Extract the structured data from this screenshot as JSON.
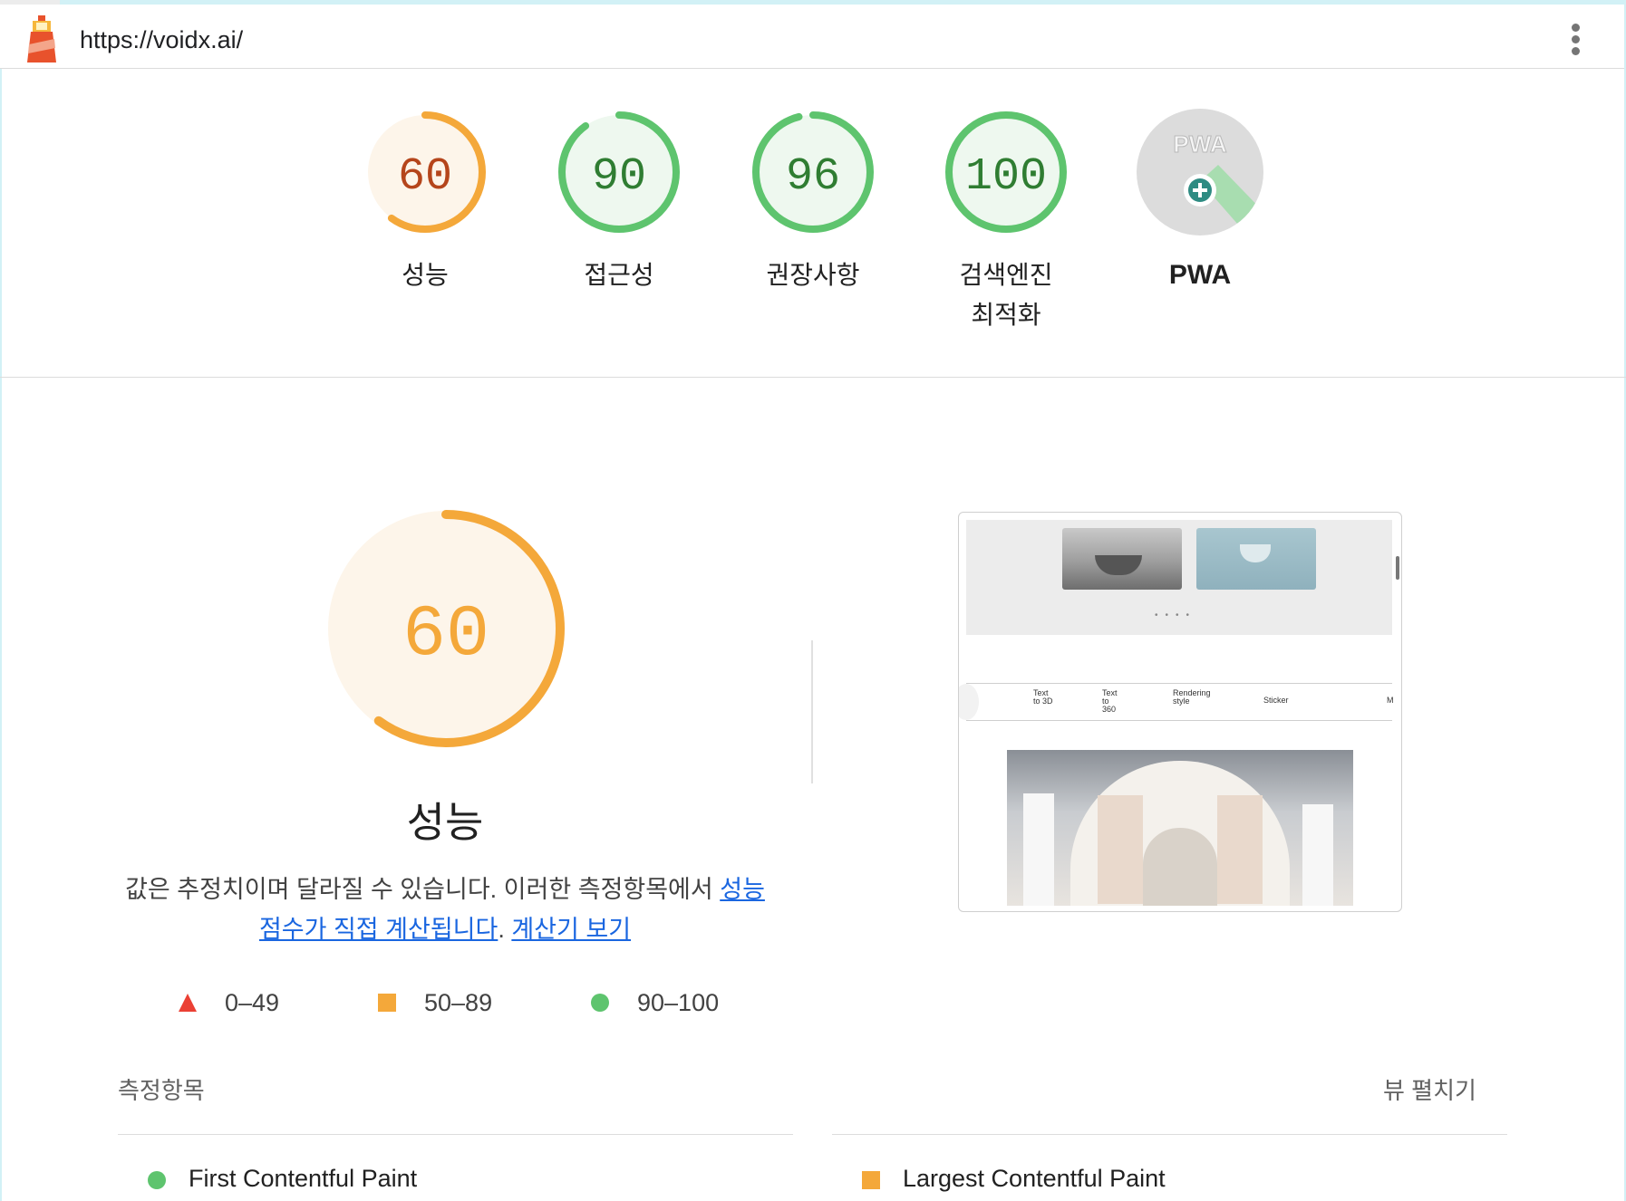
{
  "header": {
    "url": "https://voidx.ai/",
    "logo_icon": "lighthouse-icon",
    "menu_icon": "more-vertical-icon"
  },
  "scores": [
    {
      "id": "performance",
      "value": "60",
      "score": 60,
      "label": "성능",
      "status": "average"
    },
    {
      "id": "accessibility",
      "value": "90",
      "score": 90,
      "label": "접근성",
      "status": "pass"
    },
    {
      "id": "best-practices",
      "value": "96",
      "score": 96,
      "label": "권장사항",
      "status": "pass"
    },
    {
      "id": "seo",
      "value": "100",
      "score": 100,
      "label_line1": "검색엔진",
      "label_line2": "최적화",
      "status": "pass"
    },
    {
      "id": "pwa",
      "badge_text": "PWA",
      "label": "PWA",
      "icon": "pwa-plus-icon"
    }
  ],
  "performance": {
    "value": "60",
    "score": 60,
    "title": "성능",
    "desc_text": "값은 추정치이며 달라질 수 있습니다. 이러한 측정항목에서 ",
    "desc_link1": "성능 점수가 직접 계산됩니다",
    "desc_sep": ". ",
    "desc_link2": "계산기 보기"
  },
  "legend": [
    {
      "range": "0–49",
      "shape": "triangle",
      "color": "#eb4034"
    },
    {
      "range": "50–89",
      "shape": "square",
      "color": "#f4a83a"
    },
    {
      "range": "90–100",
      "shape": "circle",
      "color": "#5ec46e"
    }
  ],
  "thumbnail": {
    "tabs": [
      "Text to 3D",
      "Text to 360",
      "Rendering style",
      "Sticker",
      "M"
    ]
  },
  "metrics": {
    "heading": "측정항목",
    "expand_label": "뷰 펼치기",
    "items": [
      {
        "name": "First Contentful Paint",
        "status": "pass"
      },
      {
        "name": "Largest Contentful Paint",
        "status": "average"
      }
    ]
  },
  "colors": {
    "pass": "#5ec46e",
    "pass_bg": "#eef8ef",
    "pass_text": "#2f7d32",
    "average": "#f4a83a",
    "average_bg": "#fdf5ea",
    "average_text": "#b5451b",
    "fail": "#eb4034",
    "link": "#1a66e0"
  }
}
